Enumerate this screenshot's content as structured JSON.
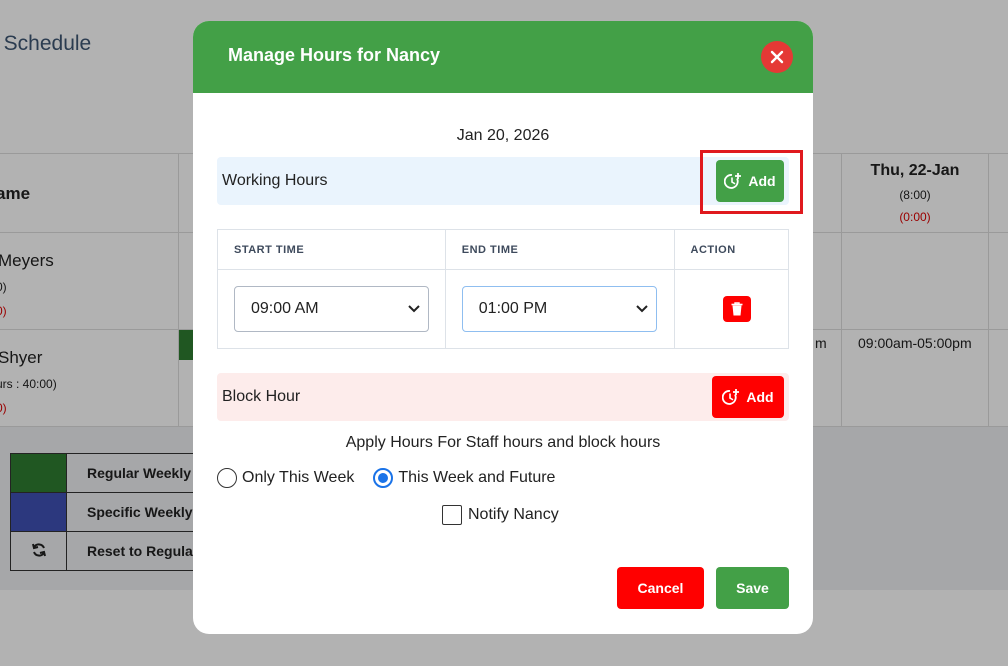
{
  "background": {
    "title": "t Schedule",
    "name_header": "ame",
    "rows": [
      {
        "name": "Meyers",
        "sub": "0)",
        "red": "0)"
      },
      {
        "name": "Shyer",
        "sub": "urs : 40:00)",
        "red": "0)"
      }
    ],
    "day_column": {
      "title": "Thu, 22-Jan",
      "hours": "(8:00)",
      "red": "(0:00)",
      "slot": "09:00am-05:00pm"
    },
    "prev_col_fragment": "m",
    "legend": [
      {
        "label": "Regular Weekly H",
        "color": "#2e7d32"
      },
      {
        "label": "Specific Weekly",
        "color": "#3f51b5"
      },
      {
        "label": "Reset to Regular",
        "icon": "refresh-icon"
      }
    ]
  },
  "modal": {
    "title": "Manage Hours for Nancy",
    "date": "Jan 20, 2026",
    "working_hours_label": "Working Hours",
    "add_label": "Add",
    "table": {
      "headers": {
        "start": "START TIME",
        "end": "END TIME",
        "action": "ACTION"
      },
      "rows": [
        {
          "start": "09:00 AM",
          "end": "01:00 PM"
        }
      ]
    },
    "block_hour_label": "Block Hour",
    "block_add_label": "Add",
    "apply_text": "Apply Hours For Staff hours and block hours",
    "radio_options": [
      {
        "label": "Only This Week",
        "checked": false
      },
      {
        "label": "This Week and Future",
        "checked": true
      }
    ],
    "notify_label": "Notify Nancy",
    "cancel_label": "Cancel",
    "save_label": "Save"
  },
  "colors": {
    "header_green": "#43a047",
    "danger_red": "#ff0000",
    "close_red": "#e53935",
    "highlight": "#e0191e",
    "radio_blue": "#1a73e8"
  }
}
